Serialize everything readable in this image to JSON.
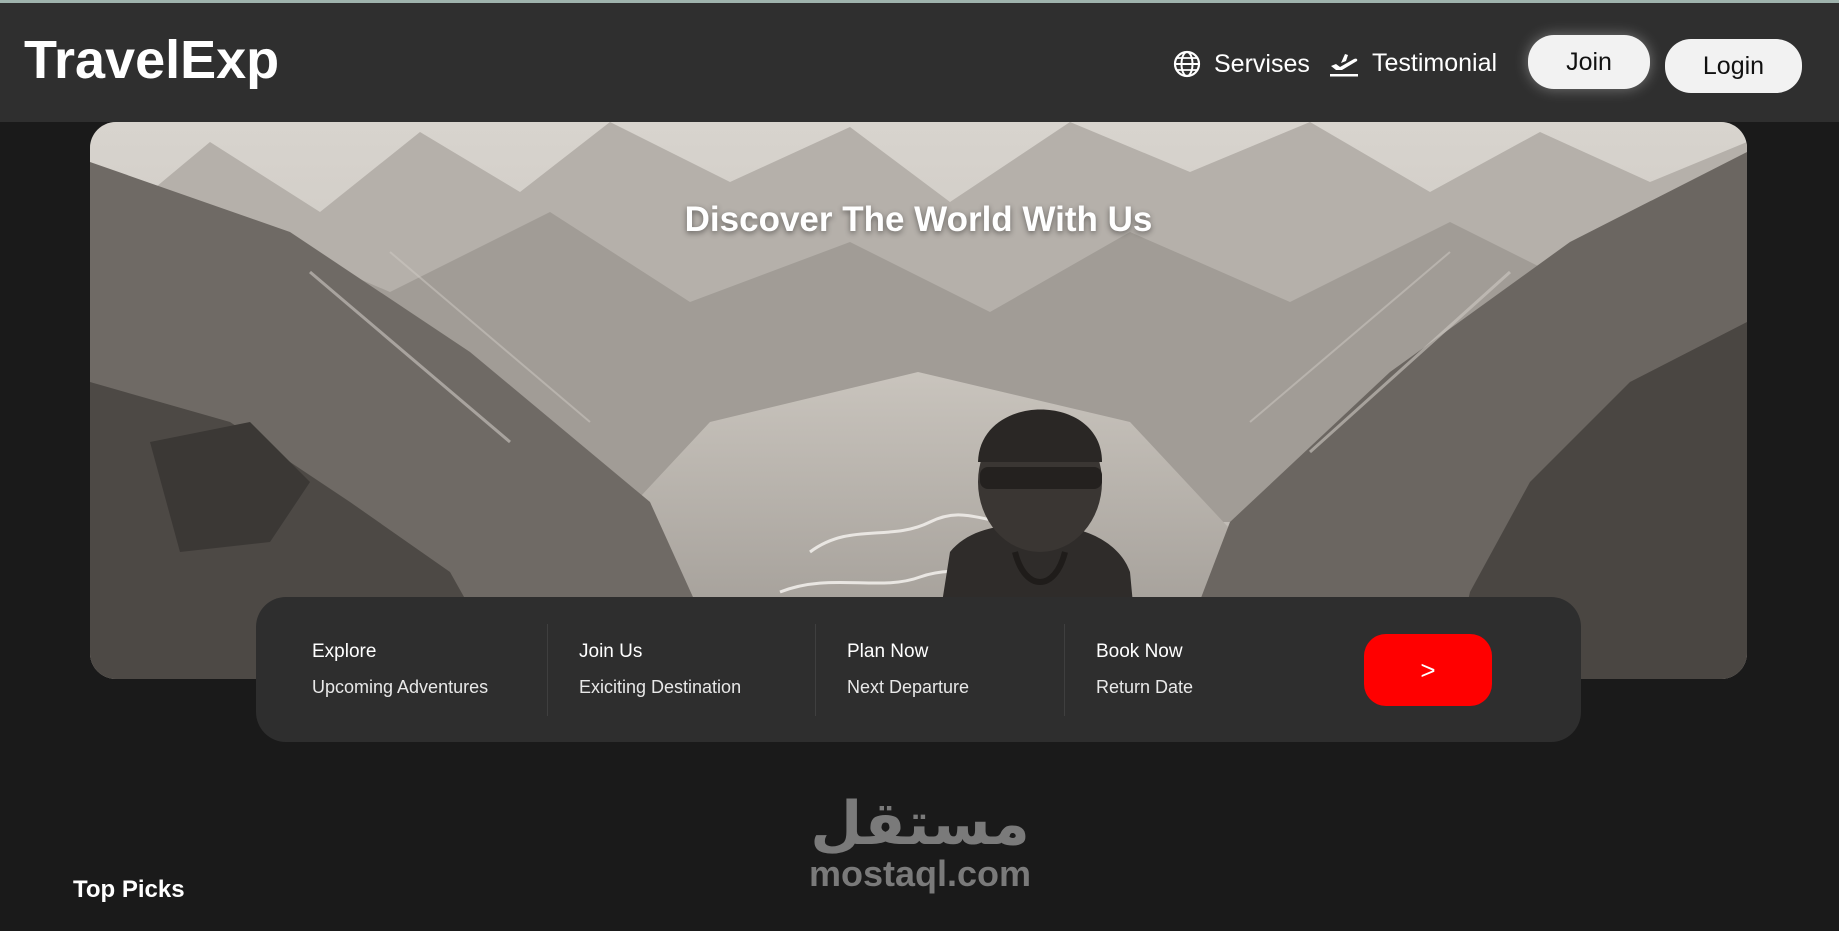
{
  "brand": {
    "name": "TravelExp"
  },
  "nav": {
    "items": [
      {
        "label": "Servises",
        "icon": "globe-icon"
      },
      {
        "label": "Testimonial",
        "icon": "airplane-takeoff-icon"
      }
    ],
    "join_label": "Join",
    "login_label": "Login"
  },
  "hero": {
    "title": "Discover The World With Us"
  },
  "search": {
    "fields": [
      {
        "label": "Explore",
        "value": "Upcoming Adventures"
      },
      {
        "label": "Join Us",
        "value": "Exiciting Destination"
      },
      {
        "label": "Plan Now",
        "value": "Next Departure"
      },
      {
        "label": "Book Now",
        "value": "Return Date"
      }
    ],
    "submit_label": ">"
  },
  "sections": {
    "top_picks_title": "Top Picks"
  },
  "watermark": {
    "arabic": "مستقل",
    "latin": "mostaql.com"
  },
  "colors": {
    "navbar_bg": "#2f2f2f",
    "page_bg": "#1a1a1a",
    "card_bg": "#2e2e2e",
    "accent": "#ff0000",
    "button_bg": "#f2f2f2"
  }
}
